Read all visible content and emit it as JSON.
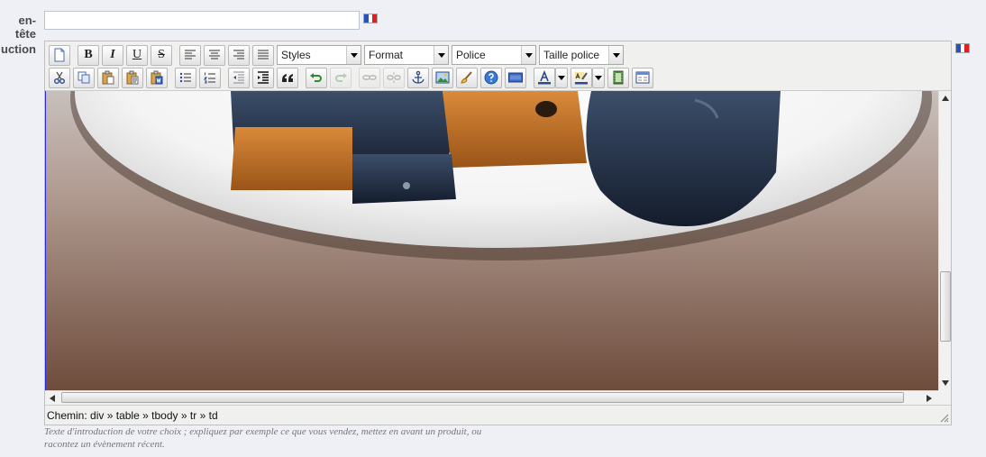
{
  "fields": {
    "header_label": "en-tête",
    "header_value": "",
    "intro_label": "uction"
  },
  "toolbar": {
    "styles_label": "Styles",
    "format_label": "Format",
    "police_label": "Police",
    "taille_label": "Taille police",
    "bold_label": "B",
    "italic_label": "I",
    "underline_label": "U",
    "strike_label": "S"
  },
  "path_bar": {
    "prefix": "Chemin:",
    "items": [
      "div",
      "table",
      "tbody",
      "tr",
      "td"
    ],
    "separator": "»"
  },
  "help_text": "Texte d'introduction de votre choix ; expliquez par exemple ce que vous vendez, mettez en avant un produit, ou racontez un évènement récent.",
  "icons": [
    "new-document-icon",
    "cut-icon",
    "copy-icon",
    "paste-icon",
    "paste-text-icon",
    "paste-word-icon",
    "align-left-icon",
    "align-center-icon",
    "align-right-icon",
    "justify-icon",
    "bullet-list-icon",
    "numbered-list-icon",
    "outdent-icon",
    "indent-icon",
    "blockquote-icon",
    "undo-icon",
    "redo-icon",
    "link-icon",
    "unlink-icon",
    "anchor-icon",
    "image-icon",
    "cleanup-icon",
    "help-icon",
    "html-icon",
    "text-color-icon",
    "highlight-color-icon",
    "media-icon",
    "template-icon",
    "resize-handle-icon"
  ],
  "colors": {
    "page_bg": "#eef0f5",
    "toolbar_bg": "#f0f0ee",
    "flag_blue": "#2b4fb5",
    "flag_red": "#e02020",
    "content_brown": "#6e4c3c"
  }
}
